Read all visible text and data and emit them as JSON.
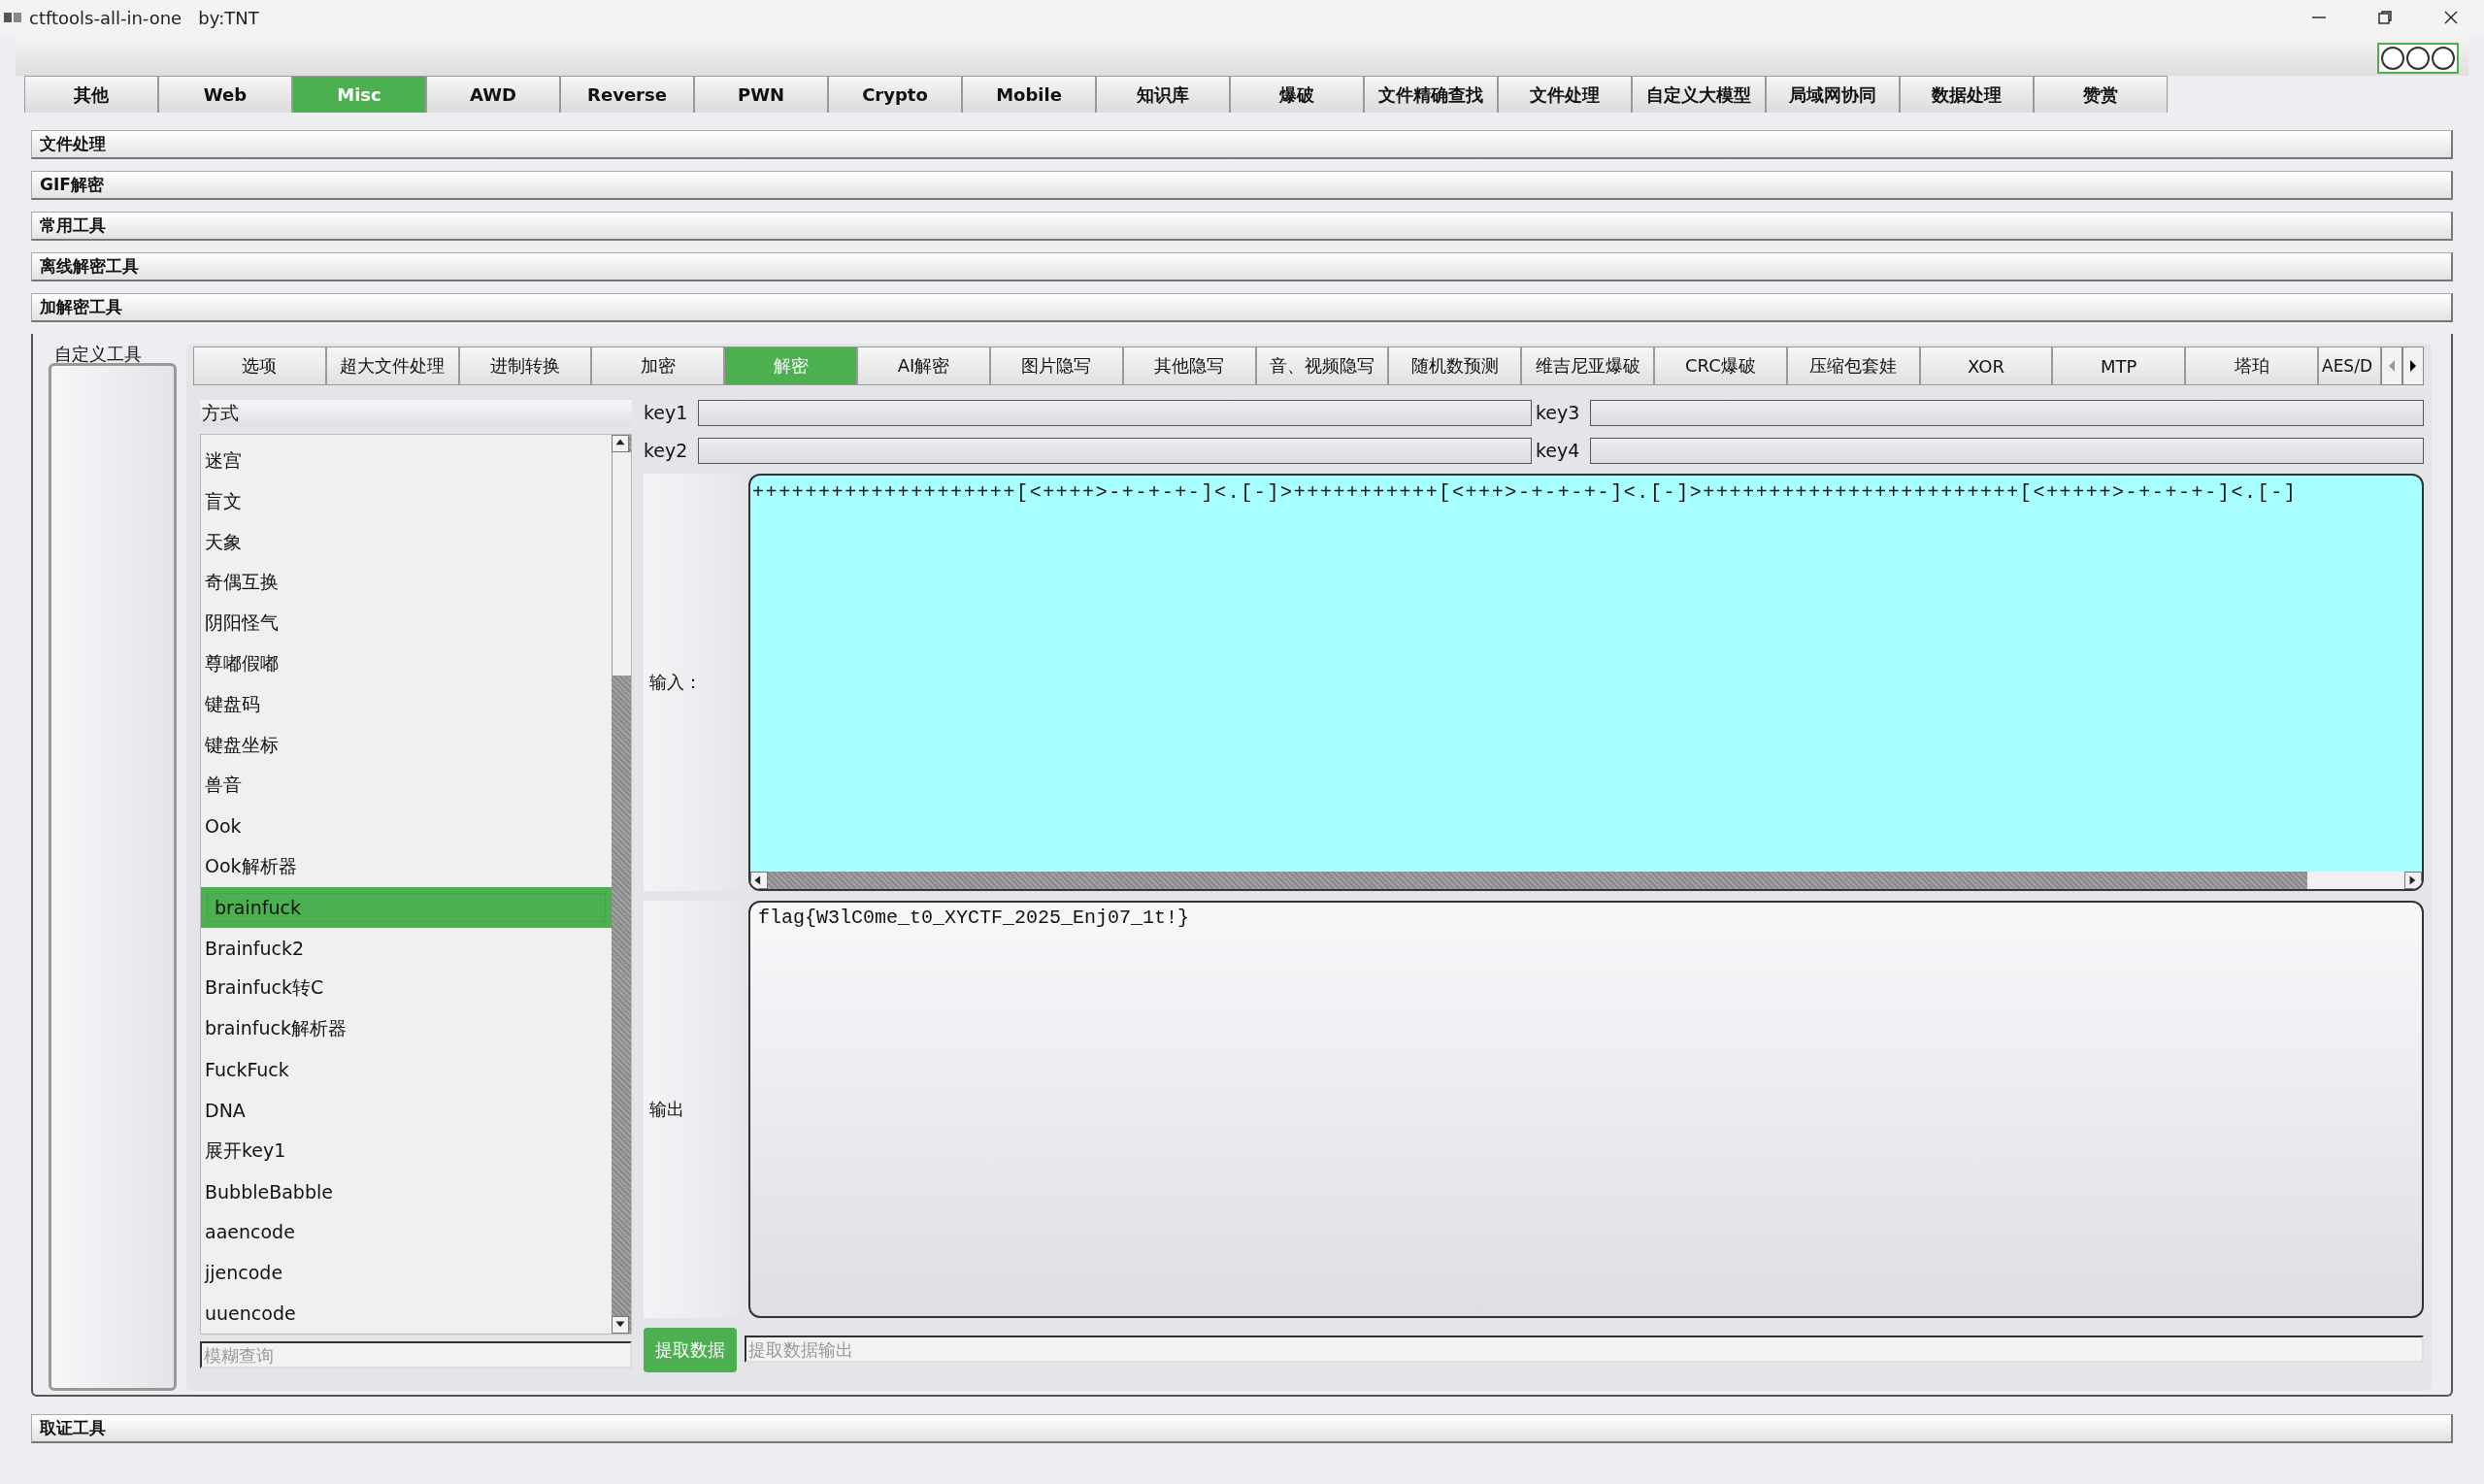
{
  "window": {
    "title": "ctftools-all-in-one   by:TNT"
  },
  "main_tabs": [
    {
      "label": "其他",
      "selected": false
    },
    {
      "label": "Web",
      "selected": false
    },
    {
      "label": "Misc",
      "selected": true
    },
    {
      "label": "AWD",
      "selected": false
    },
    {
      "label": "Reverse",
      "selected": false
    },
    {
      "label": "PWN",
      "selected": false
    },
    {
      "label": "Crypto",
      "selected": false
    },
    {
      "label": "Mobile",
      "selected": false
    },
    {
      "label": "知识库",
      "selected": false
    },
    {
      "label": "爆破",
      "selected": false
    },
    {
      "label": "文件精确查找",
      "selected": false
    },
    {
      "label": "文件处理",
      "selected": false
    },
    {
      "label": "自定义大模型",
      "selected": false
    },
    {
      "label": "局域网协同",
      "selected": false
    },
    {
      "label": "数据处理",
      "selected": false
    },
    {
      "label": "赞赏",
      "selected": false
    }
  ],
  "sections": [
    "文件处理",
    "GIF解密",
    "常用工具",
    "离线解密工具",
    "加解密工具"
  ],
  "side_panel": {
    "title": "自定义工具"
  },
  "sub_tabs": [
    {
      "label": "选项",
      "selected": false
    },
    {
      "label": "超大文件处理",
      "selected": false
    },
    {
      "label": "进制转换",
      "selected": false
    },
    {
      "label": "加密",
      "selected": false
    },
    {
      "label": "解密",
      "selected": true
    },
    {
      "label": "AI解密",
      "selected": false
    },
    {
      "label": "图片隐写",
      "selected": false
    },
    {
      "label": "其他隐写",
      "selected": false
    },
    {
      "label": "音、视频隐写",
      "selected": false
    },
    {
      "label": "随机数预测",
      "selected": false
    },
    {
      "label": "维吉尼亚爆破",
      "selected": false
    },
    {
      "label": "CRC爆破",
      "selected": false
    },
    {
      "label": "压缩包套娃",
      "selected": false
    },
    {
      "label": "XOR",
      "selected": false
    },
    {
      "label": "MTP",
      "selected": false
    },
    {
      "label": "塔珀",
      "selected": false
    },
    {
      "label": "AES/D",
      "selected": false
    }
  ],
  "method_header": "方式",
  "methods": [
    {
      "label": "迷宫",
      "selected": false
    },
    {
      "label": "盲文",
      "selected": false
    },
    {
      "label": "天象",
      "selected": false
    },
    {
      "label": "奇偶互换",
      "selected": false
    },
    {
      "label": "阴阳怪气",
      "selected": false
    },
    {
      "label": "尊嘟假嘟",
      "selected": false
    },
    {
      "label": "键盘码",
      "selected": false
    },
    {
      "label": "键盘坐标",
      "selected": false
    },
    {
      "label": "兽音",
      "selected": false
    },
    {
      "label": "Ook",
      "selected": false
    },
    {
      "label": "Ook解析器",
      "selected": false
    },
    {
      "label": "brainfuck",
      "selected": true
    },
    {
      "label": "Brainfuck2",
      "selected": false
    },
    {
      "label": "Brainfuck转C",
      "selected": false
    },
    {
      "label": "brainfuck解析器",
      "selected": false
    },
    {
      "label": "FuckFuck",
      "selected": false
    },
    {
      "label": "DNA",
      "selected": false
    },
    {
      "label": "展开key1",
      "selected": false
    },
    {
      "label": "BubbleBabble",
      "selected": false
    },
    {
      "label": "aaencode",
      "selected": false
    },
    {
      "label": "jjencode",
      "selected": false
    },
    {
      "label": "uuencode",
      "selected": false
    }
  ],
  "search": {
    "placeholder": "模糊查询"
  },
  "keys": [
    {
      "label": "key1"
    },
    {
      "label": "key3"
    },
    {
      "label": "key2"
    },
    {
      "label": "key4"
    }
  ],
  "input": {
    "label": "输入：",
    "value": "++++++++++++++++++++[<++++>-+-+-+-]<.[-]>+++++++++++[<+++>-+-+-+-]<.[-]>++++++++++++++++++++++++[<+++++>-+-+-+-]<.[-]"
  },
  "output": {
    "label": "输出",
    "value": "flag{W3lC0me_t0_XYCTF_2025_Enj07_1t!}"
  },
  "extract": {
    "button": "提取数据",
    "placeholder": "提取数据输出"
  },
  "bottom_section": "取证工具"
}
